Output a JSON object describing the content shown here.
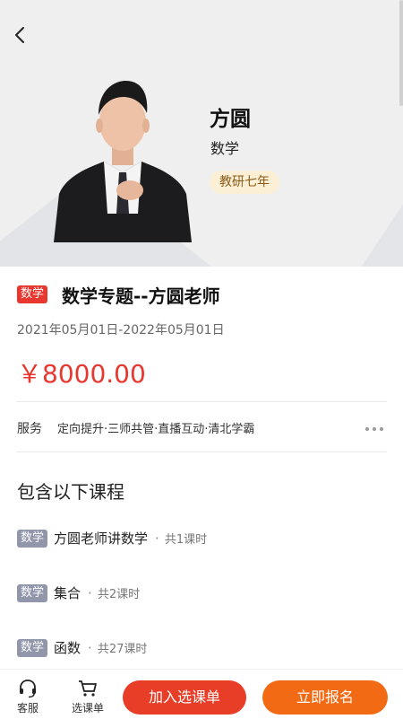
{
  "teacher": {
    "name": "方圆",
    "subject": "数学",
    "badge": "教研七年"
  },
  "course": {
    "tag": "数学",
    "title": "数学专题--方圆老师",
    "date_range": "2021年05月01日-2022年05月01日",
    "price": "￥8000.00"
  },
  "services": {
    "label": "服务",
    "items": "定向提升·三师共管·直播互动·清北学霸"
  },
  "lessons_section": {
    "title": "包含以下课程",
    "lessons": [
      {
        "tag": "数学",
        "name": "方圆老师讲数学",
        "dot": "·",
        "count": "共1课时"
      },
      {
        "tag": "数学",
        "name": "集合",
        "dot": "·",
        "count": "共2课时"
      },
      {
        "tag": "数学",
        "name": "函数",
        "dot": "·",
        "count": "共27课时"
      }
    ]
  },
  "bottom_bar": {
    "service_label": "客服",
    "cart_label": "选课单",
    "add_button": "加入选课单",
    "enroll_button": "立即报名"
  },
  "colors": {
    "accent_red": "#e8372f",
    "enroll_orange": "#f36a14",
    "badge_bg": "#fbefd5",
    "lesson_tag": "#9196ab"
  }
}
